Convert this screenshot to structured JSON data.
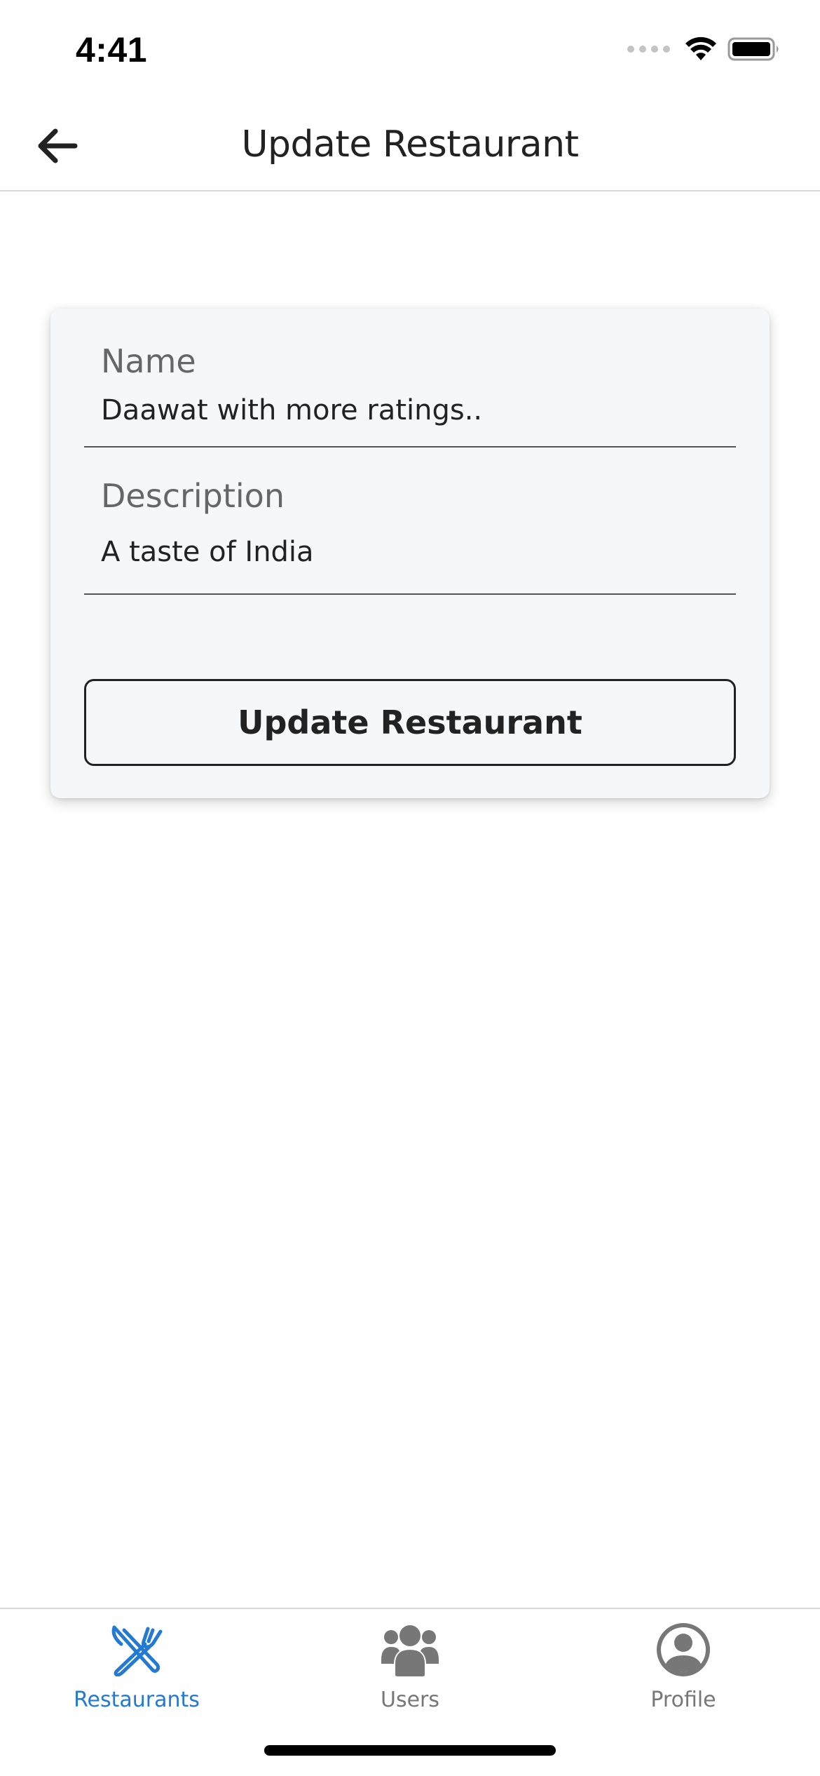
{
  "status_bar": {
    "time": "4:41"
  },
  "header": {
    "title": "Update Restaurant",
    "back_icon": "arrow-left-icon"
  },
  "form": {
    "name_label": "Name",
    "name_value": "Daawat with more ratings..",
    "description_label": "Description",
    "description_value": "A taste of India",
    "submit_label": "Update Restaurant"
  },
  "tabs": [
    {
      "label": "Restaurants",
      "icon": "fork-knife-icon",
      "active": true
    },
    {
      "label": "Users",
      "icon": "users-icon",
      "active": false
    },
    {
      "label": "Profile",
      "icon": "user-circle-icon",
      "active": false
    }
  ],
  "colors": {
    "accent": "#2479d3",
    "inactive": "#777777",
    "card_bg": "#f6f7f8",
    "text": "#222222"
  }
}
